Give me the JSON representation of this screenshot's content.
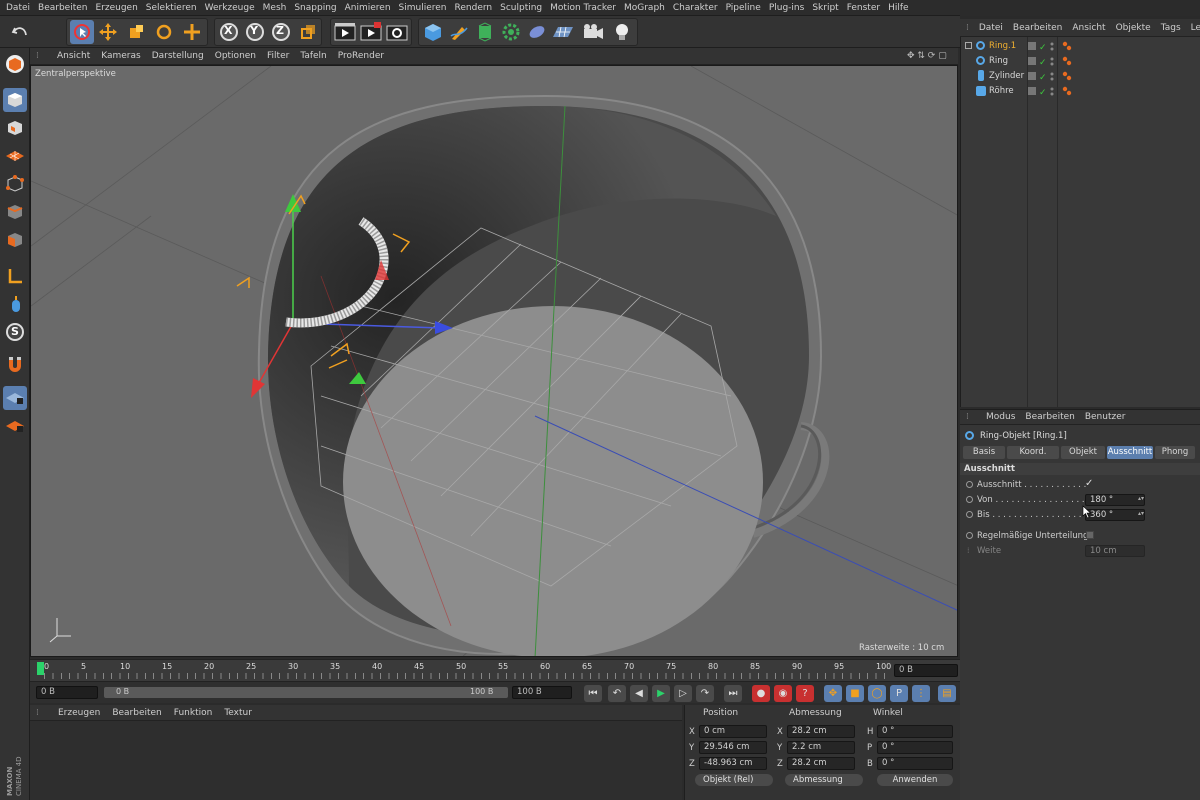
{
  "menu": [
    "Datei",
    "Bearbeiten",
    "Erzeugen",
    "Selektieren",
    "Werkzeuge",
    "Mesh",
    "Snapping",
    "Animieren",
    "Simulieren",
    "Rendern",
    "Sculpting",
    "Motion Tracker",
    "MoGraph",
    "Charakter",
    "Pipeline",
    "Plug-ins",
    "Skript",
    "Fenster",
    "Hilfe"
  ],
  "toolbar": {
    "undo_icon": "undo-icon",
    "axis_x": "X",
    "axis_y": "Y",
    "axis_z": "Z"
  },
  "lefttools": {
    "s_label": "S"
  },
  "viewport": {
    "menu": [
      "Ansicht",
      "Kameras",
      "Darstellung",
      "Optionen",
      "Filter",
      "Tafeln",
      "ProRender"
    ],
    "label": "Zentralperspektive",
    "grid_info": "Rasterweite : 10 cm"
  },
  "timeline": {
    "ticks": [
      "0",
      "5",
      "10",
      "15",
      "20",
      "25",
      "30",
      "35",
      "40",
      "45",
      "50",
      "55",
      "60",
      "65",
      "70",
      "75",
      "80",
      "85",
      "90",
      "95",
      "100"
    ],
    "current_frame_field": "0 B"
  },
  "transport": {
    "start_field": "0 B",
    "range_start": "0 B",
    "range_end": "100 B",
    "end_field": "100 B"
  },
  "material": {
    "menu": [
      "Erzeugen",
      "Bearbeiten",
      "Funktion",
      "Textur"
    ]
  },
  "coords": {
    "head_position": "Position",
    "head_size": "Abmessung",
    "head_rotation": "Winkel",
    "rows": [
      {
        "axis": "X",
        "pos": "0 cm",
        "size_axis": "X",
        "size": "28.2 cm",
        "rot_axis": "H",
        "rot": "0 °"
      },
      {
        "axis": "Y",
        "pos": "29.546 cm",
        "size_axis": "Y",
        "size": "2.2 cm",
        "rot_axis": "P",
        "rot": "0 °"
      },
      {
        "axis": "Z",
        "pos": "-48.963 cm",
        "size_axis": "Z",
        "size": "28.2 cm",
        "rot_axis": "B",
        "rot": "0 °"
      }
    ],
    "mode_dropdown": "Objekt (Rel)",
    "size_dropdown": "Abmessung",
    "apply_button": "Anwenden"
  },
  "objects": {
    "menu": [
      "Datei",
      "Bearbeiten",
      "Ansicht",
      "Objekte",
      "Tags",
      "Lesezeic"
    ],
    "items": [
      {
        "name": "Ring.1",
        "selected": true,
        "icon": "ring-icon"
      },
      {
        "name": "Ring",
        "selected": false,
        "icon": "ring-icon"
      },
      {
        "name": "Zylinder",
        "selected": false,
        "icon": "cylinder-icon"
      },
      {
        "name": "Röhre",
        "selected": false,
        "icon": "tube-icon"
      }
    ]
  },
  "attributes": {
    "menu": [
      "Modus",
      "Bearbeiten",
      "Benutzer"
    ],
    "object_title": "Ring-Objekt [Ring.1]",
    "tabs": [
      "Basis",
      "Koord.",
      "Objekt",
      "Ausschnitt",
      "Phong"
    ],
    "active_tab": "Ausschnitt",
    "section": "Ausschnitt",
    "params": [
      {
        "label": "Ausschnitt . . . . . . . . . . . .",
        "value": "✓"
      },
      {
        "label": "Von . . . . . . . . . . . . . . . . .",
        "value": "180 °"
      },
      {
        "label": "Bis . . . . . . . . . . . . . . . . . .",
        "value": "360 °"
      },
      {
        "label": "Regelmäßige Unterteilung",
        "value": ""
      },
      {
        "label": "Weite",
        "value": "10 cm"
      }
    ]
  },
  "branding": {
    "text": "MAXON CINEMA 4D"
  },
  "colors": {
    "accent": "#5c7fae",
    "selected_object": "#f0b030",
    "viewport_bg": "#6a6a6a"
  }
}
